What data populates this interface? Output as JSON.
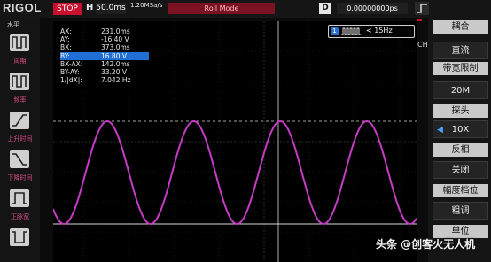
{
  "topbar": {
    "brand": "RIGOL",
    "run_state": "STOP",
    "timebase_label": "H",
    "timebase_value": "50.0ms",
    "sample_rate": "1.20MSa/s",
    "sample_depth": "",
    "mode": "Roll Mode",
    "delay_label": "D",
    "delay_value": "0.00000000ps"
  },
  "left_panel": {
    "header": "水平",
    "items": [
      {
        "label": "周期",
        "icon": "period-icon"
      },
      {
        "label": "频率",
        "icon": "frequency-icon"
      },
      {
        "label": "上升时间",
        "icon": "rise-time-icon"
      },
      {
        "label": "下降时间",
        "icon": "fall-time-icon"
      },
      {
        "label": "正脉宽",
        "icon": "positive-width-icon"
      },
      {
        "label": "",
        "icon": "negative-width-icon"
      }
    ]
  },
  "measurements": [
    {
      "key": "AX:",
      "value": "231.0ms"
    },
    {
      "key": "AY:",
      "value": "-16.40 V"
    },
    {
      "key": "BX:",
      "value": "373.0ms"
    },
    {
      "key": "BY:",
      "value": "16.80 V",
      "highlight": true
    },
    {
      "key": "BX-AX:",
      "value": "142.0ms"
    },
    {
      "key": "BY-AY:",
      "value": "33.20 V"
    },
    {
      "key": "1/|dX|:",
      "value": "7.042 Hz"
    }
  ],
  "trigger_status": "< 15Hz",
  "channel_tag": "CH1",
  "right_panel": {
    "coupling": {
      "label": "耦合",
      "value": "直流"
    },
    "bandwidth": {
      "label": "带宽限制",
      "value": "20M"
    },
    "probe": {
      "label": "探头",
      "value": "10X"
    },
    "invert": {
      "label": "反相",
      "value": "关闭"
    },
    "amplitude": {
      "label": "幅度档位",
      "value": "粗调"
    },
    "unit": {
      "label": "单位"
    }
  },
  "waveform": {
    "color": "#c43cc4",
    "type": "sine",
    "cycles_visible": 4.2
  },
  "watermark": "头条 @创客火无人机"
}
